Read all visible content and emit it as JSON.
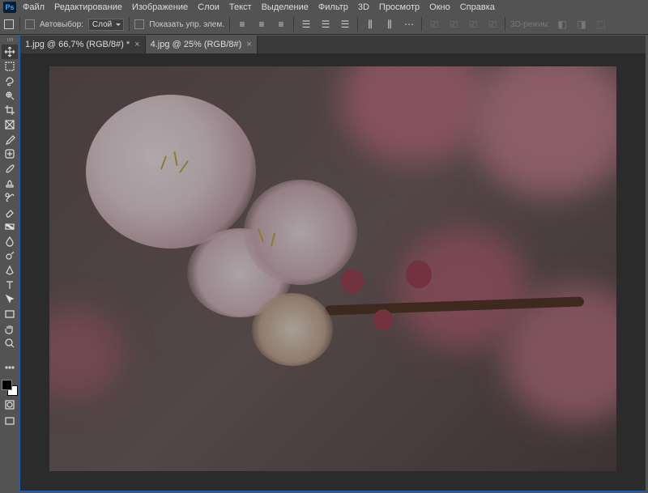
{
  "menu": {
    "items": [
      "Файл",
      "Редактирование",
      "Изображение",
      "Слои",
      "Текст",
      "Выделение",
      "Фильтр",
      "3D",
      "Просмотр",
      "Окно",
      "Справка"
    ]
  },
  "optbar": {
    "autoselect": "Автовыбор:",
    "layer": "Слой",
    "showcontrols": "Показать упр. элем.",
    "mode": "3D-режим:"
  },
  "tabs": [
    {
      "label": "1.jpg @ 66,7% (RGB/8#) *",
      "active": false
    },
    {
      "label": "4.jpg @ 25% (RGB/8#)",
      "active": true
    }
  ],
  "tools": [
    {
      "name": "move-tool",
      "sel": true
    },
    {
      "name": "marquee-tool"
    },
    {
      "name": "lasso-tool"
    },
    {
      "name": "quick-select-tool"
    },
    {
      "name": "crop-tool"
    },
    {
      "name": "frame-tool"
    },
    {
      "name": "eyedropper-tool"
    },
    {
      "name": "healing-brush-tool"
    },
    {
      "name": "brush-tool"
    },
    {
      "name": "clone-stamp-tool"
    },
    {
      "name": "history-brush-tool"
    },
    {
      "name": "eraser-tool"
    },
    {
      "name": "gradient-tool"
    },
    {
      "name": "blur-tool"
    },
    {
      "name": "dodge-tool"
    },
    {
      "name": "pen-tool"
    },
    {
      "name": "type-tool"
    },
    {
      "name": "path-select-tool"
    },
    {
      "name": "rectangle-tool"
    },
    {
      "name": "hand-tool"
    },
    {
      "name": "zoom-tool"
    }
  ],
  "extras": [
    "edit-toolbar",
    "ellipsis",
    "swatches",
    "quick-mask",
    "screen-mode"
  ]
}
